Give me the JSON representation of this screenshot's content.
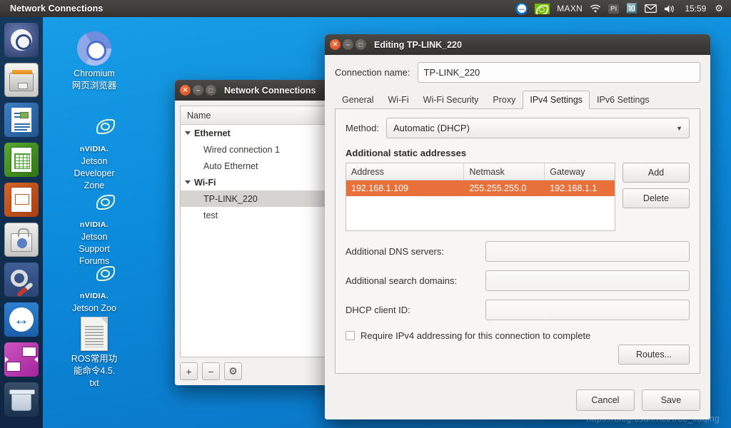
{
  "panel": {
    "title": "Network Connections",
    "tray": {
      "teamviewer_icon": "teamviewer-icon",
      "nvidia_icon": "nvidia-icon",
      "power_mode": "MAXN",
      "wifi_icon": "wifi-icon",
      "pi_badge": "Pi",
      "bluetooth_icon": "bluetooth-icon",
      "mail_icon": "mail-icon",
      "volume_icon": "volume-icon",
      "clock": "15:59",
      "session_icon": "gear-power-icon"
    }
  },
  "launcher": {
    "items": [
      {
        "name": "ubuntu-dash",
        "label": "Ubuntu Dash"
      },
      {
        "name": "files",
        "label": "Files"
      },
      {
        "name": "libreoffice-writer",
        "label": "LibreOffice Writer"
      },
      {
        "name": "libreoffice-calc",
        "label": "LibreOffice Calc"
      },
      {
        "name": "libreoffice-impress",
        "label": "LibreOffice Impress"
      },
      {
        "name": "ubuntu-software",
        "label": "Ubuntu Software"
      },
      {
        "name": "system-settings",
        "label": "System Settings"
      },
      {
        "name": "teamviewer",
        "label": "TeamViewer"
      },
      {
        "name": "remote-desktop",
        "label": "Remote Desktop"
      },
      {
        "name": "trash",
        "label": "Trash"
      }
    ]
  },
  "desktop": {
    "icons": [
      {
        "label_line1": "Chromium",
        "label_line2": "网页浏览器",
        "label_line3": ""
      },
      {
        "label_line1": "Jetson",
        "label_line2": "Developer",
        "label_line3": "Zone",
        "brand": "nVIDIA."
      },
      {
        "label_line1": "Jetson",
        "label_line2": "Support",
        "label_line3": "Forums",
        "brand": "nVIDIA."
      },
      {
        "label_line1": "Jetson Zoo",
        "label_line2": "",
        "label_line3": "",
        "brand": "nVIDIA."
      },
      {
        "label_line1": "ROS常用功",
        "label_line2": "能命令4.5.",
        "label_line3": "txt"
      }
    ]
  },
  "network_connections_window": {
    "title": "Network Connections",
    "column_header": "Name",
    "groups": [
      {
        "name": "Ethernet",
        "items": [
          "Wired connection 1",
          "Auto Ethernet"
        ]
      },
      {
        "name": "Wi-Fi",
        "items": [
          "TP-LINK_220",
          "test"
        ]
      }
    ],
    "selected_item": "TP-LINK_220",
    "toolbar": {
      "add": "+",
      "remove": "−",
      "edit": "⚙"
    }
  },
  "editing_dialog": {
    "title": "Editing TP-LINK_220",
    "connection_name_label": "Connection name:",
    "connection_name_value": "TP-LINK_220",
    "tabs": [
      "General",
      "Wi-Fi",
      "Wi-Fi Security",
      "Proxy",
      "IPv4 Settings",
      "IPv6 Settings"
    ],
    "active_tab": "IPv4 Settings",
    "method_label": "Method:",
    "method_value": "Automatic (DHCP)",
    "static_addresses": {
      "title": "Additional static addresses",
      "columns": [
        "Address",
        "Netmask",
        "Gateway"
      ],
      "rows": [
        {
          "address": "192.168.1.109",
          "netmask": "255.255.255.0",
          "gateway": "192.168.1.1",
          "selected": true
        }
      ],
      "add_button": "Add",
      "delete_button": "Delete",
      "highlight_color": "#e8703a"
    },
    "fields": [
      {
        "label": "Additional DNS servers:",
        "value": ""
      },
      {
        "label": "Additional search domains:",
        "value": ""
      },
      {
        "label": "DHCP client ID:",
        "value": ""
      }
    ],
    "require_ipv4_label": "Require IPv4 addressing for this connection to complete",
    "require_ipv4_checked": false,
    "routes_button": "Routes...",
    "cancel_button": "Cancel",
    "save_button": "Save"
  },
  "watermark": "https://blog.csdn.net/free_liuqing"
}
